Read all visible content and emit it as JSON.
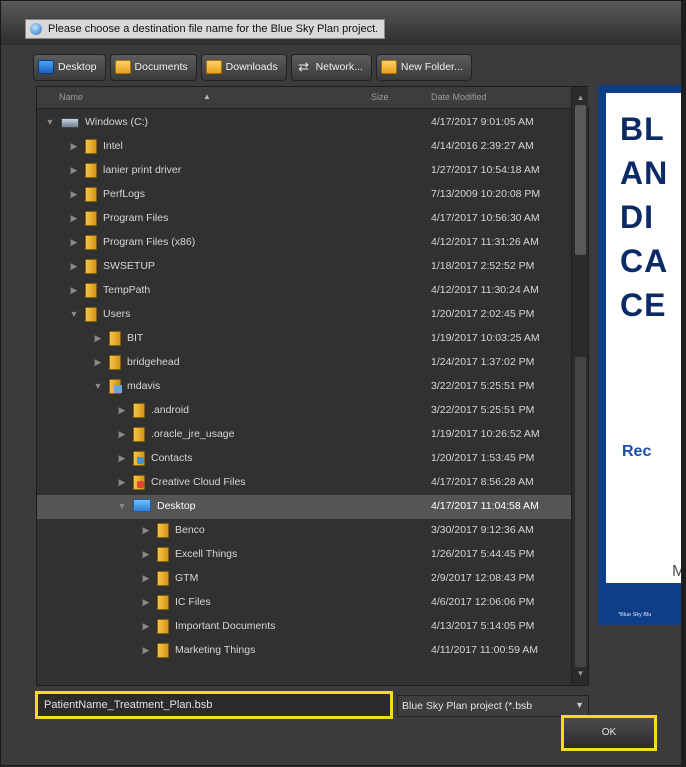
{
  "window": {
    "title": "Please choose a destination file name for the Blue Sky Plan project."
  },
  "toolbar": {
    "buttons": [
      {
        "label": "Desktop",
        "icon": "desktop-icon"
      },
      {
        "label": "Documents",
        "icon": "folder-icon"
      },
      {
        "label": "Downloads",
        "icon": "folder-icon"
      },
      {
        "label": "Network...",
        "icon": "network-icon"
      },
      {
        "label": "New Folder...",
        "icon": "new-folder-icon"
      }
    ]
  },
  "columns": {
    "name": "Name",
    "size": "Size",
    "date": "Date Modified"
  },
  "files": [
    {
      "name": "Windows (C:)",
      "date": "4/17/2017 9:01:05 AM",
      "depth": 0,
      "expanded": true,
      "type": "drive"
    },
    {
      "name": "Intel",
      "date": "4/14/2016 2:39:27 AM",
      "depth": 1,
      "expanded": false,
      "type": "folder"
    },
    {
      "name": "lanier print driver",
      "date": "1/27/2017 10:54:18 AM",
      "depth": 1,
      "expanded": false,
      "type": "folder"
    },
    {
      "name": "PerfLogs",
      "date": "7/13/2009 10:20:08 PM",
      "depth": 1,
      "expanded": false,
      "type": "folder"
    },
    {
      "name": "Program Files",
      "date": "4/17/2017 10:56:30 AM",
      "depth": 1,
      "expanded": false,
      "type": "folder"
    },
    {
      "name": "Program Files (x86)",
      "date": "4/12/2017 11:31:26 AM",
      "depth": 1,
      "expanded": false,
      "type": "folder"
    },
    {
      "name": "SWSETUP",
      "date": "1/18/2017 2:52:52 PM",
      "depth": 1,
      "expanded": false,
      "type": "folder"
    },
    {
      "name": "TempPath",
      "date": "4/12/2017 11:30:24 AM",
      "depth": 1,
      "expanded": false,
      "type": "folder"
    },
    {
      "name": "Users",
      "date": "1/20/2017 2:02:45 PM",
      "depth": 1,
      "expanded": true,
      "type": "folder"
    },
    {
      "name": "BIT",
      "date": "1/19/2017 10:03:25 AM",
      "depth": 2,
      "expanded": false,
      "type": "folder"
    },
    {
      "name": "bridgehead",
      "date": "1/24/2017 1:37:02 PM",
      "depth": 2,
      "expanded": false,
      "type": "folder"
    },
    {
      "name": "mdavis",
      "date": "3/22/2017 5:25:51 PM",
      "depth": 2,
      "expanded": true,
      "type": "open"
    },
    {
      "name": ".android",
      "date": "3/22/2017 5:25:51 PM",
      "depth": 3,
      "expanded": false,
      "type": "folder"
    },
    {
      "name": ".oracle_jre_usage",
      "date": "1/19/2017 10:26:52 AM",
      "depth": 3,
      "expanded": false,
      "type": "folder"
    },
    {
      "name": "Contacts",
      "date": "1/20/2017 1:53:45 PM",
      "depth": 3,
      "expanded": false,
      "type": "contacts"
    },
    {
      "name": "Creative Cloud Files",
      "date": "4/17/2017 8:56:28 AM",
      "depth": 3,
      "expanded": false,
      "type": "cc"
    },
    {
      "name": "Desktop",
      "date": "4/17/2017 11:04:58 AM",
      "depth": 3,
      "expanded": true,
      "type": "desk",
      "selected": true
    },
    {
      "name": "Benco",
      "date": "3/30/2017 9:12:36 AM",
      "depth": 4,
      "expanded": false,
      "type": "folder"
    },
    {
      "name": "Excell Things",
      "date": "1/26/2017 5:44:45 PM",
      "depth": 4,
      "expanded": false,
      "type": "folder"
    },
    {
      "name": "GTM",
      "date": "2/9/2017 12:08:43 PM",
      "depth": 4,
      "expanded": false,
      "type": "folder"
    },
    {
      "name": "IC Files",
      "date": "4/6/2017 12:06:06 PM",
      "depth": 4,
      "expanded": false,
      "type": "folder"
    },
    {
      "name": "Important Documents",
      "date": "4/13/2017 5:14:05 PM",
      "depth": 4,
      "expanded": false,
      "type": "folder"
    },
    {
      "name": "Marketing Things",
      "date": "4/11/2017 11:00:59 AM",
      "depth": 4,
      "expanded": false,
      "type": "folder"
    }
  ],
  "filename": {
    "value": "PatientName_Treatment_Plan.bsb"
  },
  "filetype": {
    "value": "Blue Sky Plan project (*.bsb"
  },
  "buttons": {
    "ok": "OK"
  },
  "preview": {
    "lines": [
      "BL",
      "AN",
      "DI",
      "CA",
      "CE"
    ],
    "subtitle": "Rec",
    "letter_m": "M",
    "note": "*Blue Sky Blu"
  },
  "colors": {
    "highlight": "#f2dd18",
    "preview_blue": "#0f3d87"
  }
}
